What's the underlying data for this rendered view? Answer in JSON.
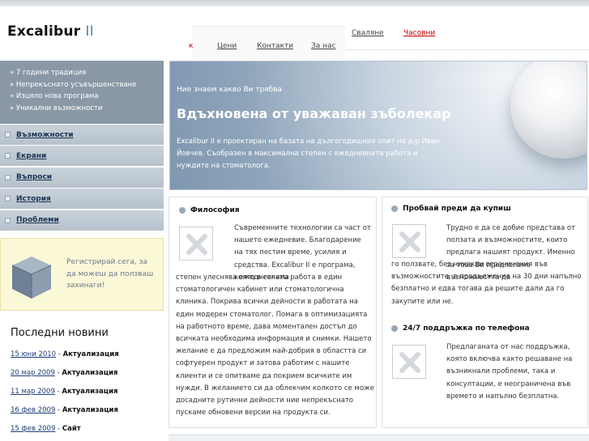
{
  "logo": {
    "name": "Excalibur",
    "version": "II"
  },
  "nav": {
    "slide_label": "Сваляне",
    "watch_label": "Часовни",
    "cut_label": "к",
    "prices_label": "Цени",
    "contacts_label": "Контакти",
    "about_label": "За нас"
  },
  "sidebar": {
    "bullets": [
      "» 7 години традиция",
      "» Непрекъснато усъвършенстване",
      "» Изцяло нова програма",
      "» Уникални възможности"
    ],
    "menu": [
      "Възможности",
      "Екрани",
      "Въпроси",
      "История",
      "Проблеми"
    ]
  },
  "promo": {
    "text": "Регистрирай сега, за да можеш да ползваш захинаги!"
  },
  "news": {
    "title": "Последни новини",
    "items": [
      {
        "date": "15 юни 2010",
        "title": "Актуализация"
      },
      {
        "date": "20 мар 2009",
        "title": "Актуализация"
      },
      {
        "date": "11 мар 2009",
        "title": "Актуализация"
      },
      {
        "date": "16 фев 2009",
        "title": "Актуализация"
      },
      {
        "date": "15 фев 2009",
        "title": "Сайт"
      }
    ]
  },
  "hero": {
    "kicker": "Ние знаем какво Ви трябва",
    "headline": "Вдъхновена от уважаван зъболекар",
    "body": "Excalibur II е проектиран на базата на дългогодишния опит на д-р Иван Йовчев. Съобразен в максимална степен с ежедневната работа и нуждите на стоматолога."
  },
  "philosophy": {
    "title": "Философия",
    "text_side": "Съвременните технологии са част от нашето ежедневие. Благодарение на тях пестим време, усилия и средства. Excalibur II е програма, която в голяма",
    "text_full": "степен улеснява ежедневната работа в един стоматологичен кабинет или стоматологична клиника. Покрива всички дейности в работата на един модерен стоматолог. Помага в оптимизацията на работното време, дава моментален достъп до всичката необходима информация и снимки.  Нашето желание е да предложим най-добрия в областта си софтуерен продукт и затова работим с нашите клиенти и се опитваме да покрием всичките им нужди. В желанието си да облекчим колкото се може досадните рутинни дейности ние непрекъснато пускаме обновени версии на продукта си."
  },
  "trial": {
    "title": "Пробвай преди да купиш",
    "text_side": "Трудно е да се добие представа от ползата и възможностите, които предлага нашият продукт. Именно за това Ви предлагаме възможността да",
    "text_full": "го ползвате, без никакви ограничения във възможностите, в продължение на 30 дни напълно безплатно и едва тогава да решите дали да го закупите или не."
  },
  "support": {
    "title": "24/7 поддръжка по телефона",
    "text_side": "Предлаганата от нас поддръжка, която включва както решаване на възникнали проблеми, така и консултации, е неограничена във времето и напълно безплатна."
  },
  "colors": {
    "accent": "#5a83b5",
    "menu_text": "#1d3557",
    "highlight": "#c00000"
  }
}
